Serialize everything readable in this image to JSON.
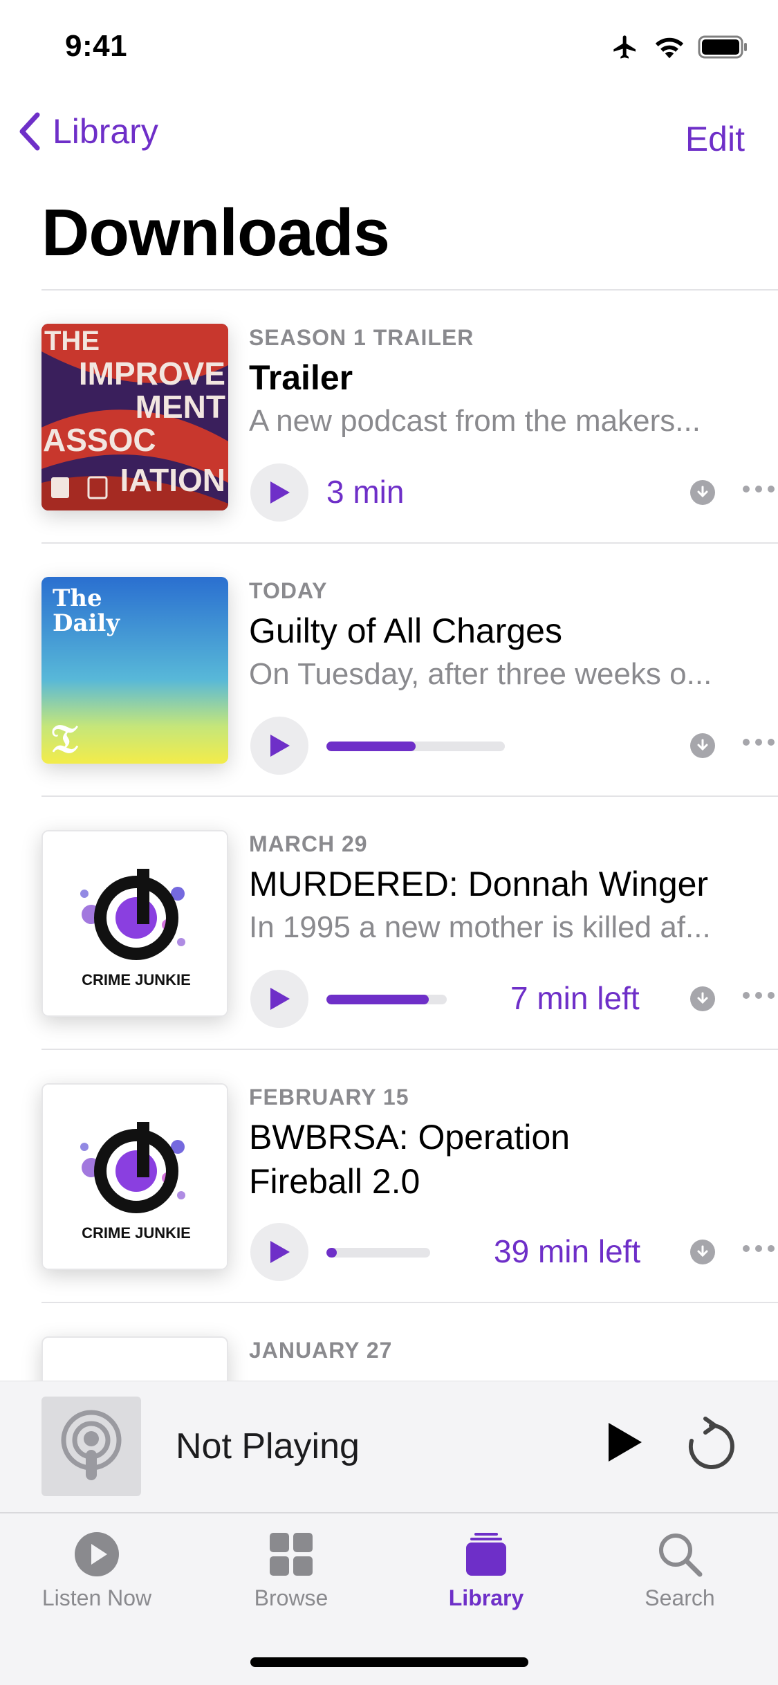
{
  "status_bar": {
    "time": "9:41",
    "icons": [
      "airplane-icon",
      "wifi-icon",
      "battery-icon"
    ]
  },
  "nav": {
    "back_label": "Library",
    "edit_label": "Edit"
  },
  "page_title": "Downloads",
  "colors": {
    "accent": "#6e2fc8",
    "secondary_text": "#8a8a8e",
    "separator": "#e3e3e6"
  },
  "episodes": [
    {
      "date": "SEASON 1 TRAILER",
      "title": "Trailer",
      "description": "A new podcast from the makers...",
      "duration": "3 min",
      "art_text": [
        "THE",
        "IMPROVE",
        "MENT",
        "ASSOC",
        "IATION"
      ]
    },
    {
      "date": "TODAY",
      "title": "Guilty of All Charges",
      "description": "On Tuesday, after three weeks o...",
      "progress": 0.5,
      "art_text": [
        "The",
        "Daily"
      ]
    },
    {
      "date": "MARCH 29",
      "title": "MURDERED: Donnah Winger",
      "description": "In 1995 a new mother is killed af...",
      "progress": 0.85,
      "remaining": "7 min left",
      "art_text": [
        "CRIME JUNKIE"
      ]
    },
    {
      "date": "FEBRUARY 15",
      "title_line1": "BWBRSA: Operation",
      "title_line2": "Fireball 2.0",
      "progress": 0.1,
      "remaining": "39 min left",
      "art_text": [
        "CRIME JUNKIE"
      ]
    },
    {
      "date": "JANUARY 27"
    }
  ],
  "mini_player": {
    "title": "Not Playing"
  },
  "tabs": [
    {
      "label": "Listen Now",
      "icon": "play-circle-icon"
    },
    {
      "label": "Browse",
      "icon": "grid-icon"
    },
    {
      "label": "Library",
      "icon": "library-icon",
      "active": true
    },
    {
      "label": "Search",
      "icon": "search-icon"
    }
  ]
}
